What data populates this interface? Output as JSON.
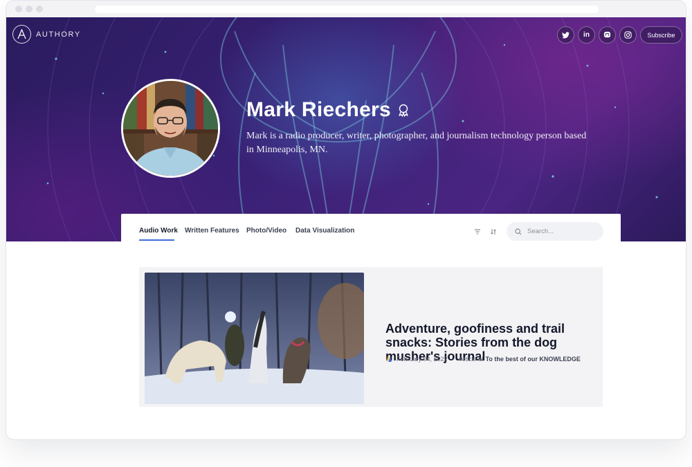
{
  "header": {
    "brand": "AUTHORY",
    "social_links": [
      {
        "name": "twitter",
        "icon": "twitter-icon"
      },
      {
        "name": "linkedin",
        "icon": "linkedin-icon",
        "glyph": "in"
      },
      {
        "name": "mastodon",
        "icon": "mastodon-icon"
      },
      {
        "name": "instagram",
        "icon": "instagram-icon"
      }
    ],
    "subscribe_label": "Subscribe"
  },
  "profile": {
    "name": "Mark Riechers",
    "bio": "Mark is a radio producer, writer, photographer, and journalism technology person based in Minneapolis, MN.",
    "badge_icon": "award-ribbon-icon"
  },
  "tabs": [
    {
      "label": "Audio Work",
      "active": true
    },
    {
      "label": "Written Features",
      "active": false
    },
    {
      "label": "Photo/Video",
      "active": false
    },
    {
      "label": "Data Visualization",
      "active": false
    }
  ],
  "toolbar": {
    "filter_icon": "filter-icon",
    "sort_icon": "sort-icon",
    "search_placeholder": "Search..."
  },
  "article": {
    "title": "Adventure, goofiness and trail snacks: Stories from the dog musher's journal",
    "date": "February 04, 2022",
    "separator": "·",
    "type_prefix": "Article at",
    "publication": "To the best of our KNOWLEDGE"
  },
  "colors": {
    "accent": "#3d6fd6",
    "hero_purple": "#3a2176",
    "card_bg": "#f3f3f5"
  }
}
